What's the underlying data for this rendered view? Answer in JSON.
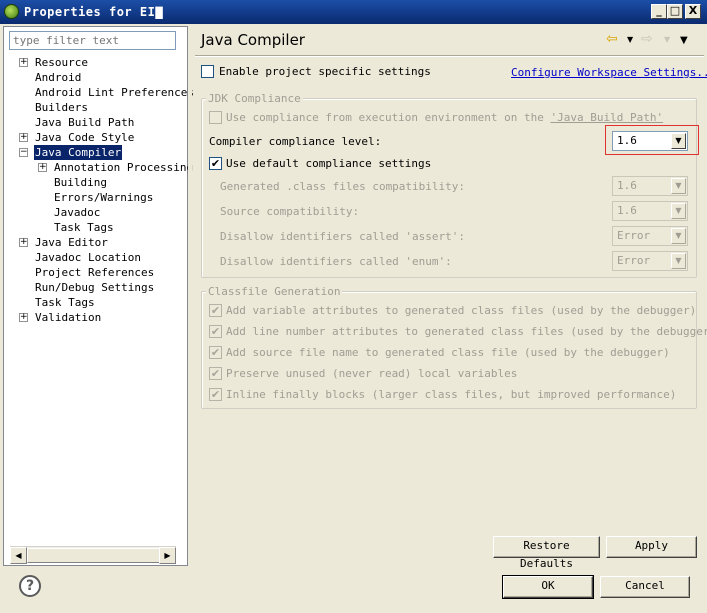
{
  "window": {
    "title": "Properties for EI▇",
    "minimize": "_",
    "maximize": "□",
    "close": "X"
  },
  "filter": {
    "placeholder": "type filter text"
  },
  "tree": [
    {
      "label": "Resource",
      "expandable": true,
      "level": 0
    },
    {
      "label": "Android",
      "expandable": false,
      "level": 0
    },
    {
      "label": "Android Lint Preferences",
      "expandable": false,
      "level": 0
    },
    {
      "label": "Builders",
      "expandable": false,
      "level": 0
    },
    {
      "label": "Java Build Path",
      "expandable": false,
      "level": 0
    },
    {
      "label": "Java Code Style",
      "expandable": true,
      "level": 0
    },
    {
      "label": "Java Compiler",
      "expandable": true,
      "expanded": true,
      "selected": true,
      "level": 0
    },
    {
      "label": "Annotation Processing",
      "expandable": true,
      "level": 1
    },
    {
      "label": "Building",
      "expandable": false,
      "level": 1
    },
    {
      "label": "Errors/Warnings",
      "expandable": false,
      "level": 1
    },
    {
      "label": "Javadoc",
      "expandable": false,
      "level": 1
    },
    {
      "label": "Task Tags",
      "expandable": false,
      "level": 1
    },
    {
      "label": "Java Editor",
      "expandable": true,
      "level": 0
    },
    {
      "label": "Javadoc Location",
      "expandable": false,
      "level": 0
    },
    {
      "label": "Project References",
      "expandable": false,
      "level": 0
    },
    {
      "label": "Run/Debug Settings",
      "expandable": false,
      "level": 0
    },
    {
      "label": "Task Tags",
      "expandable": false,
      "level": 0
    },
    {
      "label": "Validation",
      "expandable": true,
      "level": 0
    }
  ],
  "page": {
    "title": "Java Compiler",
    "enable_specific": "Enable project specific settings",
    "configure_link": "Configure Workspace Settings...",
    "jdk_group": {
      "title": "JDK Compliance",
      "use_env": "Use compliance from execution environment on the ",
      "use_env_link": "'Java Build Path'",
      "compliance_label": "Compiler compliance level:",
      "compliance_value": "1.6",
      "use_default": "Use default compliance settings",
      "rows": [
        {
          "label": "Generated .class files compatibility:",
          "value": "1.6"
        },
        {
          "label": "Source compatibility:",
          "value": "1.6"
        },
        {
          "label": "Disallow identifiers called 'assert':",
          "value": "Error"
        },
        {
          "label": "Disallow identifiers called 'enum':",
          "value": "Error"
        }
      ]
    },
    "classfile_group": {
      "title": "Classfile Generation",
      "options": [
        "Add variable attributes to generated class files (used by the debugger)",
        "Add line number attributes to generated class files (used by the debugger)",
        "Add source file name to generated class file (used by the debugger)",
        "Preserve unused (never read) local variables",
        "Inline finally blocks (larger class files, but improved performance)"
      ]
    },
    "restore_defaults": "Restore Defaults",
    "apply": "Apply"
  },
  "footer": {
    "help": "?",
    "ok": "OK",
    "cancel": "Cancel"
  },
  "colors": {
    "selection": "#0a246a",
    "highlight_border": "#e03030",
    "link": "#0000c8"
  }
}
